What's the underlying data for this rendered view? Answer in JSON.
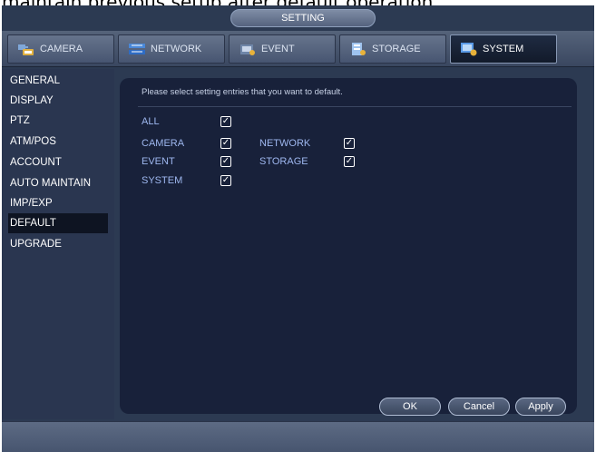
{
  "caption": "maintain previous setup after default operation.",
  "window": {
    "title": "SETTING"
  },
  "tabs": [
    {
      "label": "CAMERA",
      "icon": "camera-icon",
      "active": false
    },
    {
      "label": "NETWORK",
      "icon": "network-icon",
      "active": false
    },
    {
      "label": "EVENT",
      "icon": "event-icon",
      "active": false
    },
    {
      "label": "STORAGE",
      "icon": "storage-icon",
      "active": false
    },
    {
      "label": "SYSTEM",
      "icon": "system-icon",
      "active": true
    }
  ],
  "sidebar": {
    "items": [
      {
        "label": "GENERAL"
      },
      {
        "label": "DISPLAY"
      },
      {
        "label": "PTZ"
      },
      {
        "label": "ATM/POS"
      },
      {
        "label": "ACCOUNT"
      },
      {
        "label": "AUTO MAINTAIN"
      },
      {
        "label": "IMP/EXP"
      },
      {
        "label": "DEFAULT",
        "active": true
      },
      {
        "label": "UPGRADE"
      }
    ]
  },
  "content": {
    "instruction": "Please select setting entries that you want to default.",
    "options": {
      "all": {
        "label": "ALL",
        "checked": true
      },
      "camera": {
        "label": "CAMERA",
        "checked": true
      },
      "network": {
        "label": "NETWORK",
        "checked": true
      },
      "event": {
        "label": "EVENT",
        "checked": true
      },
      "storage": {
        "label": "STORAGE",
        "checked": true
      },
      "system": {
        "label": "SYSTEM",
        "checked": true
      }
    }
  },
  "buttons": {
    "ok": "OK",
    "cancel": "Cancel",
    "apply": "Apply"
  },
  "colors": {
    "background": "#2c3a52",
    "panel": "#18213a",
    "option_label": "#9eb7ef",
    "active_tab": "#121a2a"
  }
}
